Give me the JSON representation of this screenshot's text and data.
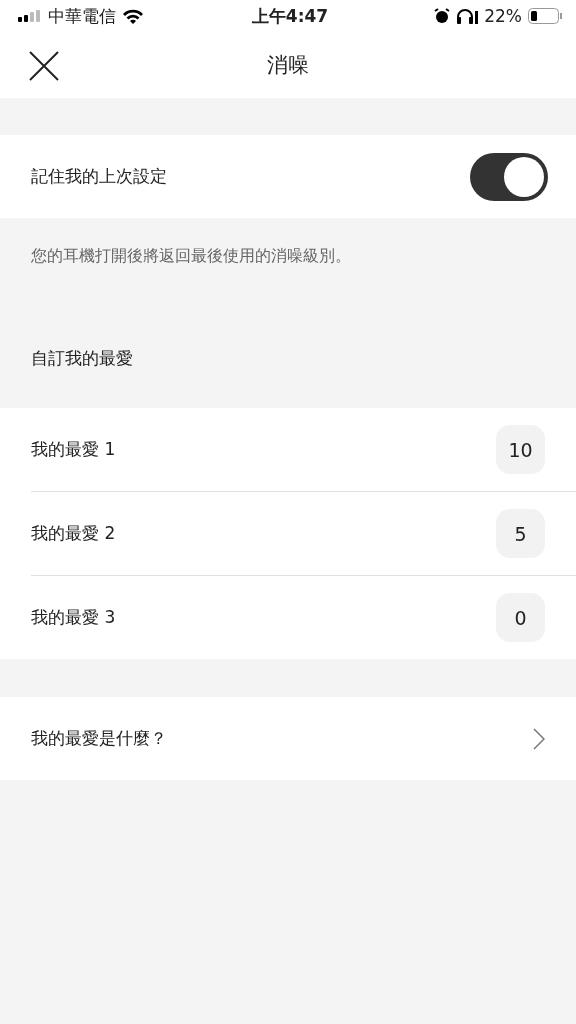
{
  "status_bar": {
    "carrier": "中華電信",
    "time": "上午4:47",
    "battery": "22%"
  },
  "nav": {
    "title": "消噪"
  },
  "remember": {
    "label": "記住我的上次設定",
    "on": true
  },
  "description": "您的耳機打開後將返回最後使用的消噪級別。",
  "favorites": {
    "header": "自訂我的最愛",
    "items": [
      {
        "label": "我的最愛 1",
        "value": "10"
      },
      {
        "label": "我的最愛 2",
        "value": "5"
      },
      {
        "label": "我的最愛 3",
        "value": "0"
      }
    ]
  },
  "help_link": {
    "label": "我的最愛是什麼？"
  }
}
